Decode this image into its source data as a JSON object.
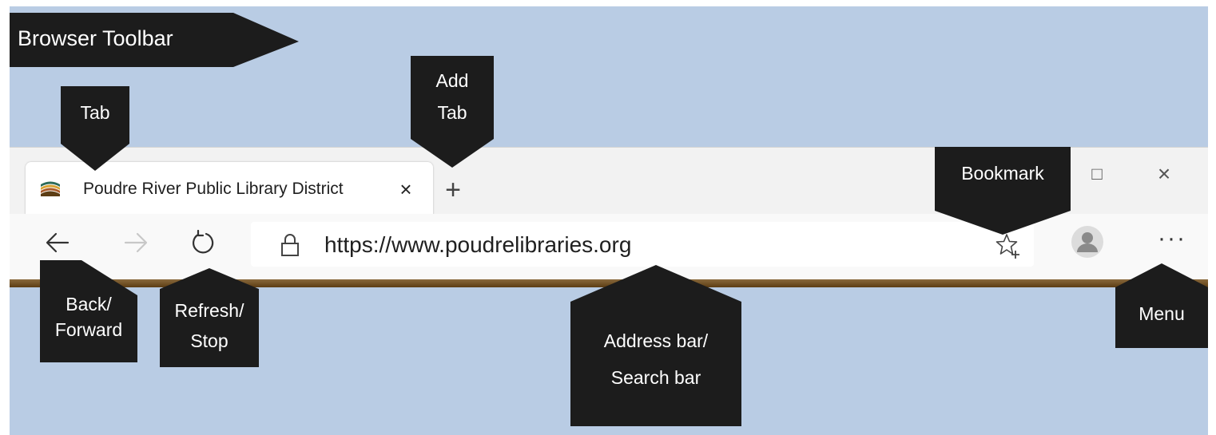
{
  "browser": {
    "tab": {
      "title": "Poudre River Public Library District",
      "close_label": "×"
    },
    "new_tab_label": "+",
    "window_controls": {
      "maximize_label": "□",
      "close_label": "×"
    },
    "toolbar": {
      "back_icon": "arrow-left-icon",
      "forward_icon": "arrow-right-icon",
      "refresh_icon": "refresh-icon",
      "address": "https://www.poudrelibraries.org",
      "bookmark_icon": "star-plus-icon",
      "profile_icon": "avatar-icon",
      "menu_label": "···"
    }
  },
  "callouts": {
    "browser_toolbar": "Browser Toolbar",
    "tab": "Tab",
    "add_tab": [
      "Add",
      "Tab"
    ],
    "bookmark": "Bookmark",
    "back_forward": [
      "Back/",
      "Forward"
    ],
    "refresh_stop": [
      "Refresh/",
      "Stop"
    ],
    "address_bar": [
      "Address bar/",
      "Search bar"
    ],
    "menu": "Menu"
  },
  "colors": {
    "background": "#b9cce4",
    "callout": "#1c1c1c",
    "toolbar_strip": "#6b4a1f"
  }
}
